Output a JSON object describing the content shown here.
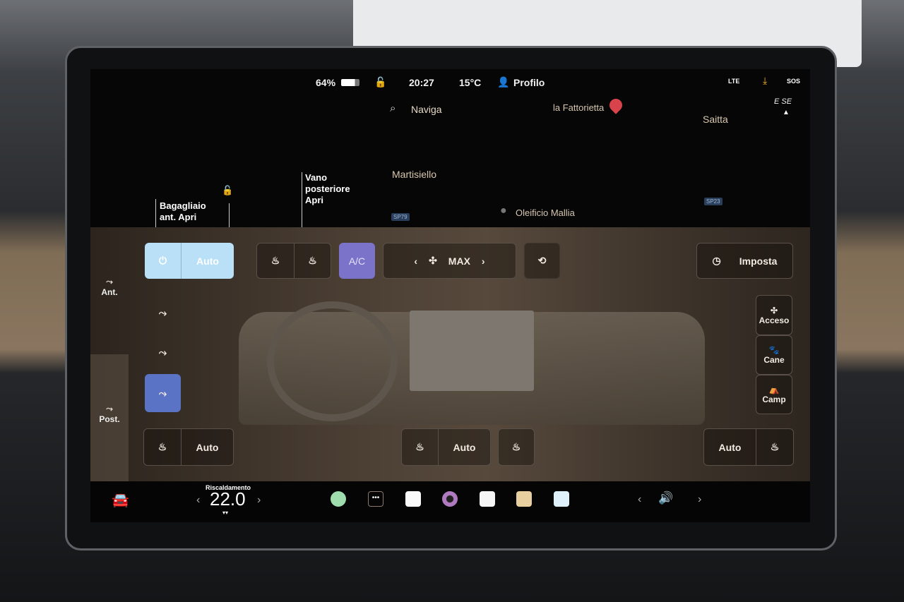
{
  "status_bar": {
    "battery": "64%",
    "time": "20:27",
    "temperature": "15°C",
    "profile": "Profilo",
    "network": "LTE",
    "sos": "SOS"
  },
  "map": {
    "search_label": "Naviga",
    "places": [
      "la Fattorietta",
      "Saitta",
      "Martisiello",
      "Oleificio Mallia"
    ],
    "road_shields": [
      "SP79",
      "SP23"
    ],
    "compass": "E SE",
    "trunk_front": "Bagagliaio ant. Apri",
    "trunk_rear": "Vano posteriore Apri"
  },
  "climate": {
    "power_auto": "Auto",
    "ac": "A/C",
    "fan_level": "MAX",
    "schedule": "Imposta",
    "front_label": "Ant.",
    "rear_label": "Post.",
    "seat_left": "Auto",
    "steering": "Auto",
    "seat_right": "Auto",
    "modes": [
      "Acceso",
      "Cane",
      "Camp"
    ],
    "accent_color": "#b9e0f7",
    "ac_color": "#7a73c9",
    "selected_vent_color": "#5a73c4"
  },
  "bottom_bar": {
    "mode_label": "Riscaldamento",
    "temperature": "22.0"
  }
}
